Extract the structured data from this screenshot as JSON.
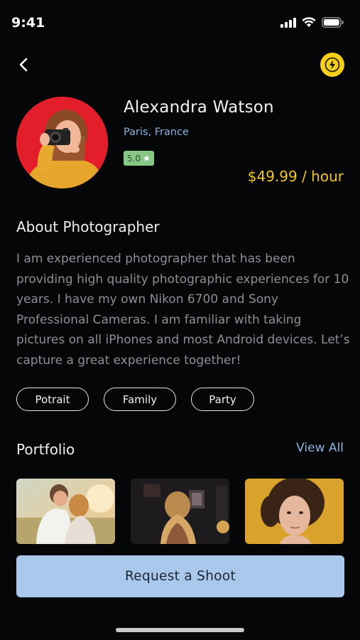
{
  "status_bar": {
    "time": "9:41"
  },
  "photographer": {
    "name": "Alexandra Watson",
    "location": "Paris, France",
    "rating": "5.0",
    "price": "$49.99 / hour"
  },
  "about": {
    "title": "About Photographer",
    "text": "I am experienced photographer that has been providing high quality photographic experiences for 10 years. I have my own Nikon 6700 and Sony Professional Cameras. I am familiar with taking pictures on all iPhones and most Android devices. Let’s capture a great experience together!"
  },
  "tags": [
    "Potrait",
    "Family",
    "Party"
  ],
  "portfolio": {
    "title": "Portfolio",
    "view_all": "View All"
  },
  "cta": {
    "label": "Request a Shoot"
  },
  "colors": {
    "accent_yellow": "#f3c51e",
    "link_blue": "#8ab4e0",
    "cta_bg": "#a9c8ec",
    "rating_green": "#86c785"
  },
  "icons": {
    "back": "chevron-left-icon",
    "flash": "lightning-icon",
    "rating": "star-icon"
  }
}
